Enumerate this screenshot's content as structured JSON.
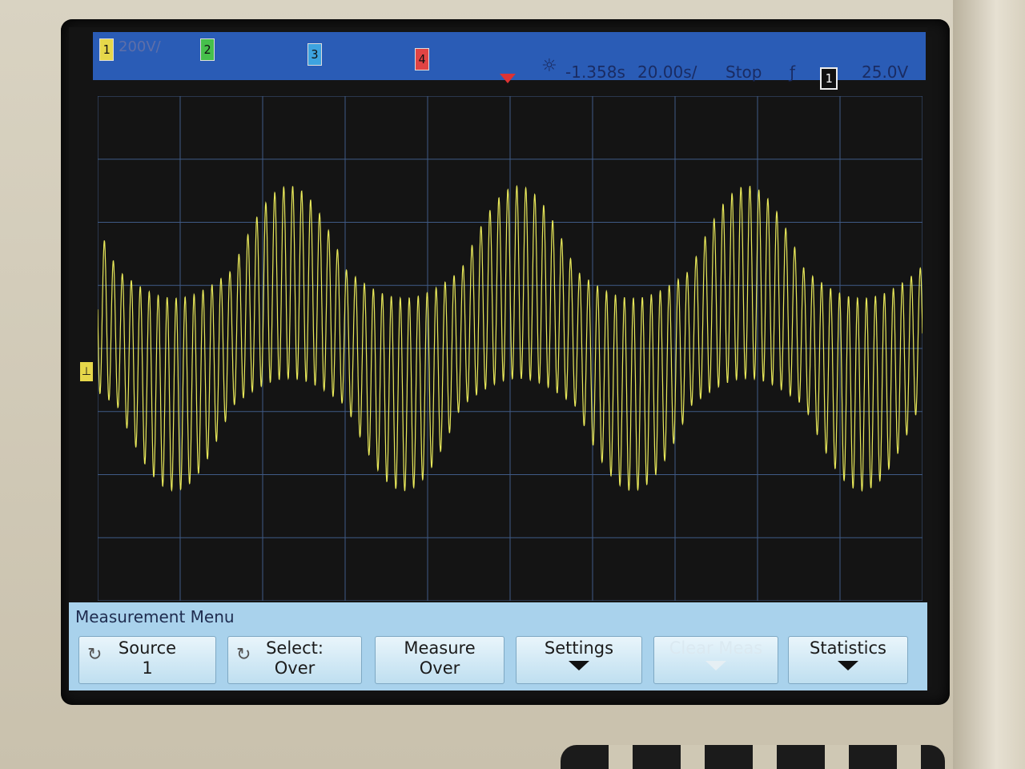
{
  "topbar": {
    "ch1_label": "1",
    "ch1_scale": "200V/",
    "ch2_label": "2",
    "ch3_label": "3",
    "ch4_label": "4",
    "time_offset": "-1.358s",
    "time_scale": "20.00s/",
    "run_state": "Stop",
    "trigger_icon": "trigger-edge-icon",
    "trigger_source": "1",
    "trigger_level": "25.0V"
  },
  "waveform": {
    "color": "#e8e85a",
    "carrier_cycles": 92,
    "envelope_cycles": 3.6
  },
  "menu": {
    "title": "Measurement Menu",
    "softkeys": [
      {
        "line1": "Source",
        "line2": "1",
        "icon": "rotate-knob-icon"
      },
      {
        "line1": "Select:",
        "line2": "Over",
        "icon": "rotate-knob-icon"
      },
      {
        "line1": "Measure",
        "line2": "Over"
      },
      {
        "line1": "Settings",
        "line2": ""
      },
      {
        "line1": "Clear Meas",
        "line2": ""
      },
      {
        "line1": "Statistics",
        "line2": ""
      }
    ]
  }
}
